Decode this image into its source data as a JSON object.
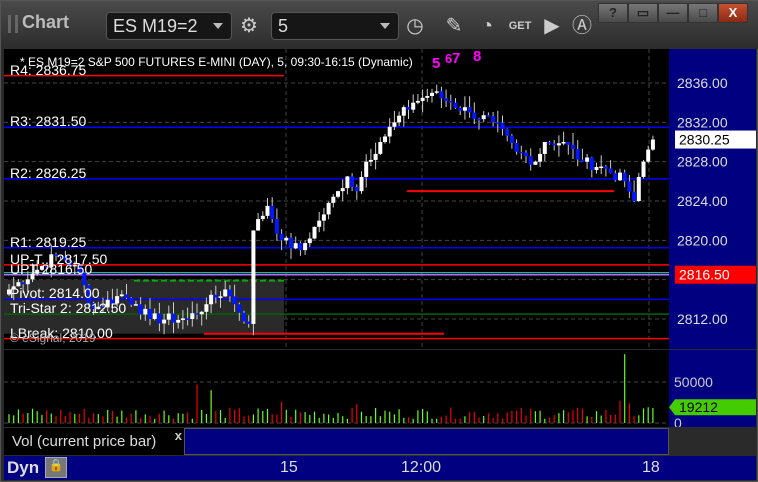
{
  "window": {
    "title": "Chart",
    "symbol": "ES M19=2",
    "interval": "5",
    "controls": [
      "?",
      "▭",
      "—",
      "□",
      "X"
    ],
    "toolbar_icons": [
      "settings-icon",
      "clock-icon",
      "pencil-icon",
      "study-icon",
      "get-icon",
      "play-icon",
      "a-icon"
    ],
    "get_label": "GET"
  },
  "chart": {
    "header": "* ES M19=2 S&P 500 FUTURES E-MINI (DAY), 5, 09:30-16:15 (Dynamic)",
    "copyright": "© eSignal, 2019",
    "levels": [
      {
        "label": "R4: 2836.75",
        "price": 2836.75,
        "color": "#ff0000"
      },
      {
        "label": "R3: 2831.50",
        "price": 2831.5,
        "color": "#0000ff"
      },
      {
        "label": "R2: 2826.25",
        "price": 2826.25,
        "color": "#0000ff"
      },
      {
        "label": "R1: 2819.25",
        "price": 2819.25,
        "color": "#0000ff"
      },
      {
        "label": "UP-T... 2817.50",
        "price": 2817.5,
        "color": "#ff0000"
      },
      {
        "label": "UPT 2816.50",
        "price": 2816.5,
        "color": "#b070ff"
      },
      {
        "label": "Pivot: 2814.00",
        "price": 2814.0,
        "color": "#0000ff"
      },
      {
        "label": "Tri-Star 2: 2812.50",
        "price": 2812.5,
        "color": "#006600"
      },
      {
        "label": "LBreak: 2810.00",
        "price": 2810.0,
        "color": "#ff0000"
      }
    ],
    "price_ticks": [
      "2836.00",
      "2832.00",
      "2828.00",
      "2824.00",
      "2820.00",
      "2812.00"
    ],
    "last_price": "2830.25",
    "marker_price": "2816.50",
    "top_counts": [
      "5",
      "6",
      "7",
      "8"
    ]
  },
  "chart_data": {
    "type": "candlestick",
    "ylim": [
      2808,
      2837.5
    ],
    "x_ticks": [
      "15",
      "12:00",
      "18"
    ],
    "close_keypoints": [
      [
        0,
        2815
      ],
      [
        6,
        2817
      ],
      [
        10,
        2818.5
      ],
      [
        14,
        2817.5
      ],
      [
        18,
        2813
      ],
      [
        24,
        2814.5
      ],
      [
        27,
        2813.5
      ],
      [
        30,
        2812
      ],
      [
        38,
        2812
      ],
      [
        42,
        2813.5
      ],
      [
        46,
        2815
      ],
      [
        48,
        2813.5
      ],
      [
        51,
        2811.5
      ],
      [
        52,
        2821
      ],
      [
        55,
        2823.5
      ],
      [
        58,
        2820
      ],
      [
        62,
        2819
      ],
      [
        66,
        2822
      ],
      [
        70,
        2825
      ],
      [
        72,
        2826.5
      ],
      [
        74,
        2825
      ],
      [
        76,
        2828
      ],
      [
        79,
        2830
      ],
      [
        82,
        2832
      ],
      [
        86,
        2834
      ],
      [
        90,
        2835
      ],
      [
        94,
        2834
      ],
      [
        98,
        2833
      ],
      [
        103,
        2832
      ],
      [
        108,
        2829
      ],
      [
        112,
        2828
      ],
      [
        114,
        2830
      ],
      [
        118,
        2830
      ],
      [
        122,
        2828
      ],
      [
        126,
        2827.5
      ],
      [
        131,
        2826
      ],
      [
        133,
        2824
      ],
      [
        135,
        2828
      ],
      [
        137,
        2830.25
      ]
    ],
    "volume": {
      "ylim": [
        0,
        90000
      ],
      "ticks": [
        "50000",
        "0"
      ],
      "last": "19212",
      "spikes": [
        [
          40,
          47000,
          "red"
        ],
        [
          43,
          40000,
          "green"
        ],
        [
          58,
          26000,
          "red"
        ],
        [
          74,
          23000,
          "red"
        ],
        [
          130,
          27000,
          "red"
        ],
        [
          131,
          84000,
          "green"
        ],
        [
          132,
          24000,
          "red"
        ],
        [
          136,
          19212,
          "green"
        ]
      ]
    }
  },
  "volume_panel": {
    "label": "Vol (current price bar)",
    "close": "x"
  },
  "status": {
    "dyn": "Dyn"
  }
}
